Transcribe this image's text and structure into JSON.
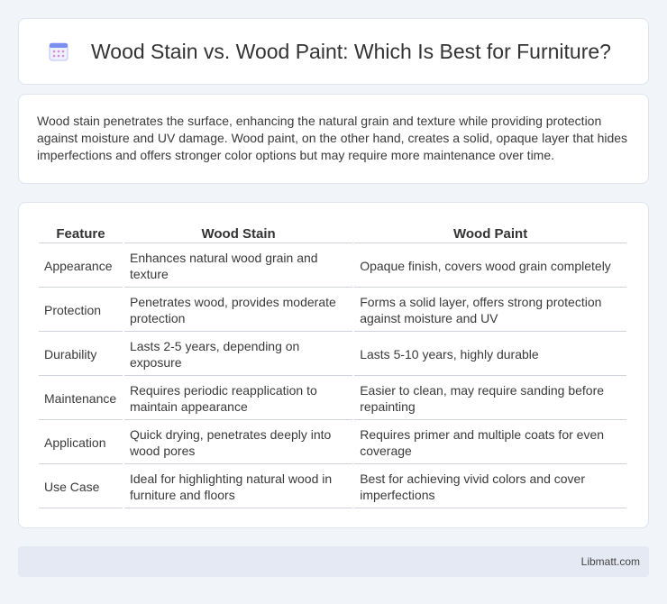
{
  "header": {
    "title": "Wood Stain vs. Wood Paint: Which Is Best for Furniture?",
    "icon": "calendar-icon",
    "icon_color": "#7b8ff0"
  },
  "intro": {
    "text": "Wood stain penetrates the surface, enhancing the natural grain and texture while providing protection against moisture and UV damage. Wood paint, on the other hand, creates a solid, opaque layer that hides imperfections and offers stronger color options but may require more maintenance over time."
  },
  "table": {
    "headers": [
      "Feature",
      "Wood Stain",
      "Wood Paint"
    ],
    "rows": [
      [
        "Appearance",
        "Enhances natural wood grain and texture",
        "Opaque finish, covers wood grain completely"
      ],
      [
        "Protection",
        "Penetrates wood, provides moderate protection",
        "Forms a solid layer, offers strong protection against moisture and UV"
      ],
      [
        "Durability",
        "Lasts 2-5 years, depending on exposure",
        "Lasts 5-10 years, highly durable"
      ],
      [
        "Maintenance",
        "Requires periodic reapplication to maintain appearance",
        "Easier to clean, may require sanding before repainting"
      ],
      [
        "Application",
        "Quick drying, penetrates deeply into wood pores",
        "Requires primer and multiple coats for even coverage"
      ],
      [
        "Use Case",
        "Ideal for highlighting natural wood in furniture and floors",
        "Best for achieving vivid colors and cover imperfections"
      ]
    ]
  },
  "footer": {
    "site": "Libmatt.com"
  }
}
